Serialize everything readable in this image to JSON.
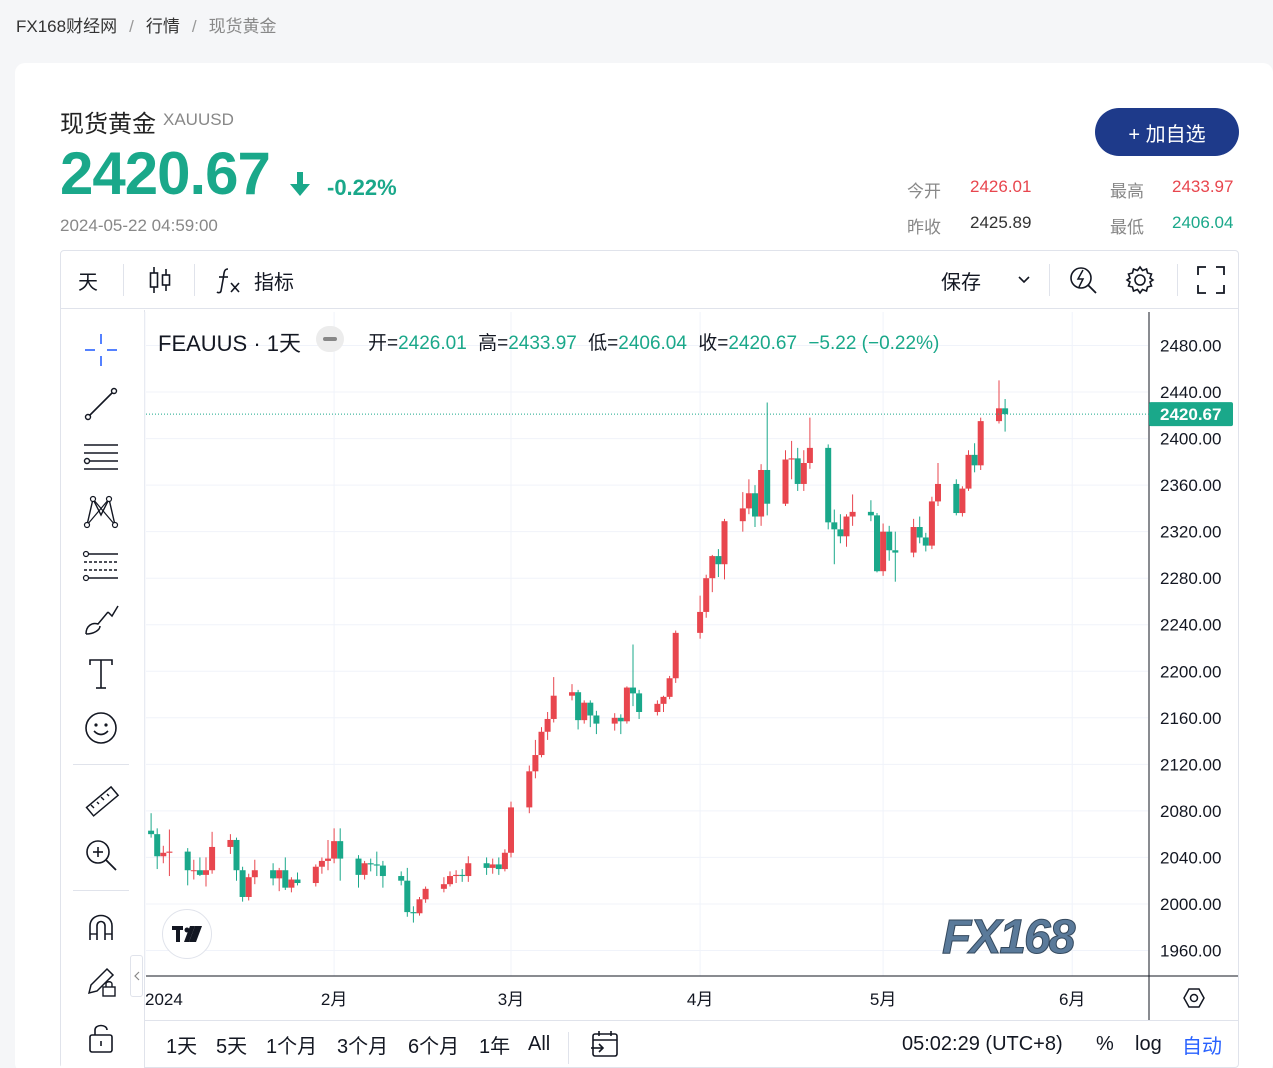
{
  "breadcrumb": [
    "FX168财经网",
    "行情",
    "现货黄金"
  ],
  "breadcrumb_sep": "/",
  "header": {
    "title": "现货黄金",
    "symbol": "XAUUSD",
    "price": "2420.67",
    "change": "-0.22%",
    "timestamp": "2024-05-22 04:59:00",
    "add_button": "+ 加自选"
  },
  "stats": {
    "open_label": "今开",
    "open": "2426.01",
    "high_label": "最高",
    "high": "2433.97",
    "prev_label": "昨收",
    "prev": "2425.89",
    "low_label": "最低",
    "low": "2406.04"
  },
  "toolbar": {
    "interval": "天",
    "indicator_label": "指标",
    "save_label": "保存"
  },
  "legend": {
    "symbol": "FEAUUS · 1天",
    "o_label": "开=",
    "o": "2426.01",
    "h_label": "高=",
    "h": "2433.97",
    "l_label": "低=",
    "l": "2406.04",
    "c_label": "收=",
    "c": "2420.67",
    "chg": "−5.22 (−0.22%)"
  },
  "bottom": {
    "ranges": [
      "1天",
      "5天",
      "1个月",
      "3个月",
      "6个月",
      "1年",
      "All"
    ],
    "time": "05:02:29 (UTC+8)",
    "pct": "%",
    "log": "log",
    "auto": "自动"
  },
  "watermark": "FX168",
  "colors": {
    "up": "#e8464e",
    "down": "#1aa88a",
    "accent": "#1e3a8a",
    "auto": "#2962ff"
  },
  "chart_data": {
    "type": "candlestick",
    "title": "FEAUUS · 1天",
    "y_ticks": [
      "2480.00",
      "2440.00",
      "2400.00",
      "2360.00",
      "2320.00",
      "2280.00",
      "2240.00",
      "2200.00",
      "2160.00",
      "2120.00",
      "2080.00",
      "2040.00",
      "2000.00",
      "1960.00"
    ],
    "ylim": [
      1938,
      2505
    ],
    "x_ticks": [
      "2024",
      "2月",
      "3月",
      "4月",
      "5月",
      "6月"
    ],
    "last_price_label": "2420.67",
    "grid": true,
    "candles": [
      {
        "d": "2024-01-02",
        "o": 2063,
        "h": 2078,
        "l": 2057,
        "c": 2060
      },
      {
        "d": "2024-01-03",
        "o": 2060,
        "h": 2065,
        "l": 2030,
        "c": 2041
      },
      {
        "d": "2024-01-04",
        "o": 2041,
        "h": 2050,
        "l": 2035,
        "c": 2044
      },
      {
        "d": "2024-01-05",
        "o": 2044,
        "h": 2064,
        "l": 2024,
        "c": 2045
      },
      {
        "d": "2024-01-08",
        "o": 2045,
        "h": 2048,
        "l": 2016,
        "c": 2029
      },
      {
        "d": "2024-01-09",
        "o": 2029,
        "h": 2038,
        "l": 2021,
        "c": 2029
      },
      {
        "d": "2024-01-10",
        "o": 2029,
        "h": 2040,
        "l": 2024,
        "c": 2025
      },
      {
        "d": "2024-01-11",
        "o": 2025,
        "h": 2040,
        "l": 2015,
        "c": 2029
      },
      {
        "d": "2024-01-12",
        "o": 2029,
        "h": 2062,
        "l": 2026,
        "c": 2049
      },
      {
        "d": "2024-01-15",
        "o": 2049,
        "h": 2060,
        "l": 2043,
        "c": 2055
      },
      {
        "d": "2024-01-16",
        "o": 2055,
        "h": 2057,
        "l": 2020,
        "c": 2029
      },
      {
        "d": "2024-01-17",
        "o": 2029,
        "h": 2032,
        "l": 2002,
        "c": 2006
      },
      {
        "d": "2024-01-18",
        "o": 2006,
        "h": 2026,
        "l": 2003,
        "c": 2023
      },
      {
        "d": "2024-01-19",
        "o": 2023,
        "h": 2038,
        "l": 2017,
        "c": 2029
      },
      {
        "d": "2024-01-22",
        "o": 2029,
        "h": 2035,
        "l": 2016,
        "c": 2022
      },
      {
        "d": "2024-01-23",
        "o": 2022,
        "h": 2031,
        "l": 2011,
        "c": 2029
      },
      {
        "d": "2024-01-24",
        "o": 2029,
        "h": 2040,
        "l": 2012,
        "c": 2014
      },
      {
        "d": "2024-01-25",
        "o": 2014,
        "h": 2023,
        "l": 2010,
        "c": 2021
      },
      {
        "d": "2024-01-26",
        "o": 2021,
        "h": 2027,
        "l": 2016,
        "c": 2018
      },
      {
        "d": "2024-01-29",
        "o": 2018,
        "h": 2034,
        "l": 2015,
        "c": 2032
      },
      {
        "d": "2024-01-30",
        "o": 2032,
        "h": 2040,
        "l": 2026,
        "c": 2037
      },
      {
        "d": "2024-01-31",
        "o": 2037,
        "h": 2055,
        "l": 2029,
        "c": 2039
      },
      {
        "d": "2024-02-01",
        "o": 2039,
        "h": 2065,
        "l": 2035,
        "c": 2054
      },
      {
        "d": "2024-02-02",
        "o": 2054,
        "h": 2065,
        "l": 2020,
        "c": 2039
      },
      {
        "d": "2024-02-05",
        "o": 2039,
        "h": 2042,
        "l": 2014,
        "c": 2025
      },
      {
        "d": "2024-02-06",
        "o": 2025,
        "h": 2037,
        "l": 2021,
        "c": 2035
      },
      {
        "d": "2024-02-07",
        "o": 2035,
        "h": 2039,
        "l": 2028,
        "c": 2034
      },
      {
        "d": "2024-02-08",
        "o": 2034,
        "h": 2045,
        "l": 2024,
        "c": 2033
      },
      {
        "d": "2024-02-09",
        "o": 2033,
        "h": 2037,
        "l": 2014,
        "c": 2024
      },
      {
        "d": "2024-02-12",
        "o": 2024,
        "h": 2028,
        "l": 2016,
        "c": 2020
      },
      {
        "d": "2024-02-13",
        "o": 2020,
        "h": 2031,
        "l": 1989,
        "c": 1993
      },
      {
        "d": "2024-02-14",
        "o": 1993,
        "h": 1998,
        "l": 1984,
        "c": 1992
      },
      {
        "d": "2024-02-15",
        "o": 1992,
        "h": 2006,
        "l": 1990,
        "c": 2004
      },
      {
        "d": "2024-02-16",
        "o": 2004,
        "h": 2015,
        "l": 2001,
        "c": 2013
      },
      {
        "d": "2024-02-19",
        "o": 2013,
        "h": 2023,
        "l": 2010,
        "c": 2017
      },
      {
        "d": "2024-02-20",
        "o": 2017,
        "h": 2028,
        "l": 2015,
        "c": 2024
      },
      {
        "d": "2024-02-21",
        "o": 2024,
        "h": 2029,
        "l": 2018,
        "c": 2025
      },
      {
        "d": "2024-02-22",
        "o": 2025,
        "h": 2030,
        "l": 2019,
        "c": 2024
      },
      {
        "d": "2024-02-23",
        "o": 2024,
        "h": 2041,
        "l": 2019,
        "c": 2035
      },
      {
        "d": "2024-02-26",
        "o": 2035,
        "h": 2040,
        "l": 2025,
        "c": 2031
      },
      {
        "d": "2024-02-27",
        "o": 2031,
        "h": 2039,
        "l": 2026,
        "c": 2034
      },
      {
        "d": "2024-02-28",
        "o": 2034,
        "h": 2040,
        "l": 2025,
        "c": 2030
      },
      {
        "d": "2024-02-29",
        "o": 2030,
        "h": 2047,
        "l": 2028,
        "c": 2044
      },
      {
        "d": "2024-03-01",
        "o": 2044,
        "h": 2088,
        "l": 2040,
        "c": 2083
      },
      {
        "d": "2024-03-04",
        "o": 2083,
        "h": 2119,
        "l": 2078,
        "c": 2114
      },
      {
        "d": "2024-03-05",
        "o": 2114,
        "h": 2141,
        "l": 2108,
        "c": 2128
      },
      {
        "d": "2024-03-06",
        "o": 2128,
        "h": 2152,
        "l": 2126,
        "c": 2148
      },
      {
        "d": "2024-03-07",
        "o": 2148,
        "h": 2165,
        "l": 2141,
        "c": 2159
      },
      {
        "d": "2024-03-08",
        "o": 2159,
        "h": 2195,
        "l": 2156,
        "c": 2179
      },
      {
        "d": "2024-03-11",
        "o": 2179,
        "h": 2189,
        "l": 2175,
        "c": 2182
      },
      {
        "d": "2024-03-12",
        "o": 2182,
        "h": 2184,
        "l": 2150,
        "c": 2158
      },
      {
        "d": "2024-03-13",
        "o": 2158,
        "h": 2175,
        "l": 2155,
        "c": 2173
      },
      {
        "d": "2024-03-14",
        "o": 2173,
        "h": 2175,
        "l": 2152,
        "c": 2162
      },
      {
        "d": "2024-03-15",
        "o": 2162,
        "h": 2166,
        "l": 2146,
        "c": 2155
      },
      {
        "d": "2024-03-18",
        "o": 2155,
        "h": 2164,
        "l": 2149,
        "c": 2160
      },
      {
        "d": "2024-03-19",
        "o": 2160,
        "h": 2163,
        "l": 2146,
        "c": 2157
      },
      {
        "d": "2024-03-20",
        "o": 2157,
        "h": 2187,
        "l": 2155,
        "c": 2186
      },
      {
        "d": "2024-03-21",
        "o": 2186,
        "h": 2223,
        "l": 2170,
        "c": 2181
      },
      {
        "d": "2024-03-22",
        "o": 2181,
        "h": 2184,
        "l": 2159,
        "c": 2165
      },
      {
        "d": "2024-03-25",
        "o": 2165,
        "h": 2175,
        "l": 2162,
        "c": 2172
      },
      {
        "d": "2024-03-26",
        "o": 2172,
        "h": 2179,
        "l": 2165,
        "c": 2178
      },
      {
        "d": "2024-03-27",
        "o": 2178,
        "h": 2196,
        "l": 2176,
        "c": 2194
      },
      {
        "d": "2024-03-28",
        "o": 2194,
        "h": 2235,
        "l": 2190,
        "c": 2233
      },
      {
        "d": "2024-04-01",
        "o": 2233,
        "h": 2265,
        "l": 2228,
        "c": 2251
      },
      {
        "d": "2024-04-02",
        "o": 2251,
        "h": 2283,
        "l": 2246,
        "c": 2280
      },
      {
        "d": "2024-04-03",
        "o": 2280,
        "h": 2300,
        "l": 2268,
        "c": 2299
      },
      {
        "d": "2024-04-04",
        "o": 2299,
        "h": 2305,
        "l": 2281,
        "c": 2292
      },
      {
        "d": "2024-04-05",
        "o": 2292,
        "h": 2331,
        "l": 2279,
        "c": 2329
      },
      {
        "d": "2024-04-08",
        "o": 2329,
        "h": 2354,
        "l": 2320,
        "c": 2340
      },
      {
        "d": "2024-04-09",
        "o": 2340,
        "h": 2365,
        "l": 2335,
        "c": 2353
      },
      {
        "d": "2024-04-10",
        "o": 2353,
        "h": 2360,
        "l": 2324,
        "c": 2333
      },
      {
        "d": "2024-04-11",
        "o": 2333,
        "h": 2378,
        "l": 2325,
        "c": 2373
      },
      {
        "d": "2024-04-12",
        "o": 2373,
        "h": 2431,
        "l": 2334,
        "c": 2344
      },
      {
        "d": "2024-04-15",
        "o": 2344,
        "h": 2390,
        "l": 2342,
        "c": 2382
      },
      {
        "d": "2024-04-16",
        "o": 2382,
        "h": 2398,
        "l": 2365,
        "c": 2383
      },
      {
        "d": "2024-04-17",
        "o": 2383,
        "h": 2392,
        "l": 2355,
        "c": 2361
      },
      {
        "d": "2024-04-18",
        "o": 2361,
        "h": 2390,
        "l": 2355,
        "c": 2379
      },
      {
        "d": "2024-04-19",
        "o": 2379,
        "h": 2418,
        "l": 2374,
        "c": 2392
      },
      {
        "d": "2024-04-22",
        "o": 2392,
        "h": 2395,
        "l": 2322,
        "c": 2328
      },
      {
        "d": "2024-04-23",
        "o": 2328,
        "h": 2339,
        "l": 2292,
        "c": 2322
      },
      {
        "d": "2024-04-24",
        "o": 2322,
        "h": 2335,
        "l": 2310,
        "c": 2316
      },
      {
        "d": "2024-04-25",
        "o": 2316,
        "h": 2335,
        "l": 2307,
        "c": 2333
      },
      {
        "d": "2024-04-26",
        "o": 2333,
        "h": 2352,
        "l": 2325,
        "c": 2337
      },
      {
        "d": "2024-04-29",
        "o": 2337,
        "h": 2347,
        "l": 2329,
        "c": 2334
      },
      {
        "d": "2024-04-30",
        "o": 2334,
        "h": 2336,
        "l": 2285,
        "c": 2286
      },
      {
        "d": "2024-05-01",
        "o": 2286,
        "h": 2327,
        "l": 2282,
        "c": 2320
      },
      {
        "d": "2024-05-02",
        "o": 2320,
        "h": 2325,
        "l": 2295,
        "c": 2304
      },
      {
        "d": "2024-05-03",
        "o": 2304,
        "h": 2320,
        "l": 2277,
        "c": 2302
      },
      {
        "d": "2024-05-06",
        "o": 2302,
        "h": 2331,
        "l": 2298,
        "c": 2324
      },
      {
        "d": "2024-05-07",
        "o": 2324,
        "h": 2333,
        "l": 2310,
        "c": 2315
      },
      {
        "d": "2024-05-08",
        "o": 2315,
        "h": 2319,
        "l": 2303,
        "c": 2308
      },
      {
        "d": "2024-05-09",
        "o": 2308,
        "h": 2350,
        "l": 2305,
        "c": 2346
      },
      {
        "d": "2024-05-10",
        "o": 2346,
        "h": 2379,
        "l": 2342,
        "c": 2361
      },
      {
        "d": "2024-05-13",
        "o": 2361,
        "h": 2365,
        "l": 2334,
        "c": 2336
      },
      {
        "d": "2024-05-14",
        "o": 2336,
        "h": 2359,
        "l": 2333,
        "c": 2357
      },
      {
        "d": "2024-05-15",
        "o": 2357,
        "h": 2390,
        "l": 2355,
        "c": 2386
      },
      {
        "d": "2024-05-16",
        "o": 2386,
        "h": 2396,
        "l": 2371,
        "c": 2377
      },
      {
        "d": "2024-05-17",
        "o": 2377,
        "h": 2418,
        "l": 2373,
        "c": 2415
      },
      {
        "d": "2024-05-20",
        "o": 2415,
        "h": 2450,
        "l": 2413,
        "c": 2426
      },
      {
        "d": "2024-05-21",
        "o": 2426,
        "h": 2434,
        "l": 2406,
        "c": 2421
      }
    ]
  }
}
